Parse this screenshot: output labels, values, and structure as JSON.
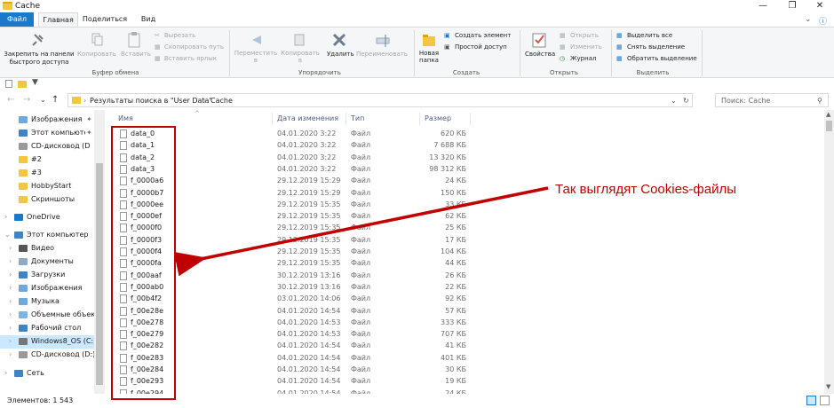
{
  "window": {
    "title": "Cache"
  },
  "ribbon_tabs": [
    "Файл",
    "Главная",
    "Поделиться",
    "Вид"
  ],
  "ribbon": {
    "clipboard": {
      "pin": "Закрепить на панели быстрого доступа",
      "copy": "Копировать",
      "paste": "Вставить",
      "cut": "Вырезать",
      "copy_path": "Скопировать путь",
      "paste_shortcut": "Вставить ярлык",
      "label": "Буфер обмена"
    },
    "organize": {
      "move_to": "Переместить в",
      "copy_to": "Копировать в",
      "delete": "Удалить",
      "rename": "Переименовать",
      "label": "Упорядочить"
    },
    "new": {
      "new_folder": "Новая папка",
      "new_item": "Создать элемент",
      "easy_access": "Простой доступ",
      "label": "Создать"
    },
    "open": {
      "properties": "Свойства",
      "open": "Открыть",
      "edit": "Изменить",
      "history": "Журнал",
      "label": "Открыть"
    },
    "select": {
      "select_all": "Выделить все",
      "select_none": "Снять выделение",
      "invert": "Обратить выделение",
      "label": "Выделить"
    }
  },
  "address": {
    "crumbs": [
      "Результаты поиска в \"User Data\"",
      "Cache"
    ],
    "search_placeholder": "Поиск: Cache"
  },
  "nav": [
    {
      "label": "Изображения",
      "icon": "pictures-icon",
      "pinned": true
    },
    {
      "label": "Этот компьютер",
      "icon": "computer-icon",
      "pinned": true
    },
    {
      "label": "CD-дисковод (D",
      "icon": "cd-drive-icon",
      "pinned": false
    },
    {
      "label": "#2",
      "icon": "folder-icon",
      "pinned": false
    },
    {
      "label": "#3",
      "icon": "folder-icon",
      "pinned": false
    },
    {
      "label": "HobbyStart",
      "icon": "folder-icon",
      "pinned": false
    },
    {
      "label": "Скриншоты",
      "icon": "folder-icon",
      "pinned": false
    },
    {
      "label": "OneDrive",
      "icon": "onedrive-icon",
      "pinned": false
    },
    {
      "label": "Этот компьютер",
      "icon": "computer-icon",
      "pinned": false
    },
    {
      "label": "Видео",
      "icon": "video-icon",
      "pinned": false
    },
    {
      "label": "Документы",
      "icon": "documents-icon",
      "pinned": false
    },
    {
      "label": "Загрузки",
      "icon": "downloads-icon",
      "pinned": false
    },
    {
      "label": "Изображения",
      "icon": "pictures-icon",
      "pinned": false
    },
    {
      "label": "Музыка",
      "icon": "music-icon",
      "pinned": false
    },
    {
      "label": "Объемные объект",
      "icon": "3d-objects-icon",
      "pinned": false
    },
    {
      "label": "Рабочий стол",
      "icon": "desktop-icon",
      "pinned": false
    },
    {
      "label": "Windows8_OS (C:)",
      "icon": "disk-icon",
      "pinned": false
    },
    {
      "label": "CD-дисковод (D:) 1",
      "icon": "cd-drive-icon",
      "pinned": false
    },
    {
      "label": "Сеть",
      "icon": "network-icon",
      "pinned": false
    }
  ],
  "columns": [
    "Имя",
    "Дата изменения",
    "Тип",
    "Размер"
  ],
  "files": [
    {
      "name": "data_0",
      "date": "04.01.2020 3:22",
      "type": "Файл",
      "size": "620 КБ"
    },
    {
      "name": "data_1",
      "date": "04.01.2020 3:22",
      "type": "Файл",
      "size": "7 688 КБ"
    },
    {
      "name": "data_2",
      "date": "04.01.2020 3:22",
      "type": "Файл",
      "size": "13 320 КБ"
    },
    {
      "name": "data_3",
      "date": "04.01.2020 3:22",
      "type": "Файл",
      "size": "98 312 КБ"
    },
    {
      "name": "f_0000a6",
      "date": "29.12.2019 15:29",
      "type": "Файл",
      "size": "24 КБ"
    },
    {
      "name": "f_0000b7",
      "date": "29.12.2019 15:29",
      "type": "Файл",
      "size": "150 КБ"
    },
    {
      "name": "f_0000ee",
      "date": "29.12.2019 15:35",
      "type": "Файл",
      "size": "33 КБ"
    },
    {
      "name": "f_0000ef",
      "date": "29.12.2019 15:35",
      "type": "Файл",
      "size": "62 КБ"
    },
    {
      "name": "f_0000f0",
      "date": "29.12.2019 15:35",
      "type": "Файл",
      "size": "25 КБ"
    },
    {
      "name": "f_0000f3",
      "date": "29.12.2019 15:35",
      "type": "Файл",
      "size": "17 КБ"
    },
    {
      "name": "f_0000f4",
      "date": "29.12.2019 15:35",
      "type": "Файл",
      "size": "104 КБ"
    },
    {
      "name": "f_0000fa",
      "date": "29.12.2019 15:35",
      "type": "Файл",
      "size": "44 КБ"
    },
    {
      "name": "f_000aaf",
      "date": "30.12.2019 13:16",
      "type": "Файл",
      "size": "26 КБ"
    },
    {
      "name": "f_000ab0",
      "date": "30.12.2019 13:16",
      "type": "Файл",
      "size": "22 КБ"
    },
    {
      "name": "f_00b4f2",
      "date": "03.01.2020 14:06",
      "type": "Файл",
      "size": "92 КБ"
    },
    {
      "name": "f_00e28e",
      "date": "04.01.2020 14:54",
      "type": "Файл",
      "size": "57 КБ"
    },
    {
      "name": "f_00e278",
      "date": "04.01.2020 14:53",
      "type": "Файл",
      "size": "333 КБ"
    },
    {
      "name": "f_00e279",
      "date": "04.01.2020 14:53",
      "type": "Файл",
      "size": "707 КБ"
    },
    {
      "name": "f_00e282",
      "date": "04.01.2020 14:54",
      "type": "Файл",
      "size": "41 КБ"
    },
    {
      "name": "f_00e283",
      "date": "04.01.2020 14:54",
      "type": "Файл",
      "size": "401 КБ"
    },
    {
      "name": "f_00e284",
      "date": "04.01.2020 14:54",
      "type": "Файл",
      "size": "30 КБ"
    },
    {
      "name": "f_00e293",
      "date": "04.01.2020 14:54",
      "type": "Файл",
      "size": "19 КБ"
    },
    {
      "name": "f_00e294",
      "date": "04.01.2020 14:54",
      "type": "Файл",
      "size": "24 КБ"
    }
  ],
  "status": {
    "count": "Элементов: 1 543"
  },
  "annotation": {
    "text": "Так выглядят Cookies-файлы",
    "color": "#c00000"
  },
  "colors": {
    "file_tab": "#1979ca",
    "selection": "#cce8ff",
    "highlight": "#c00000"
  }
}
